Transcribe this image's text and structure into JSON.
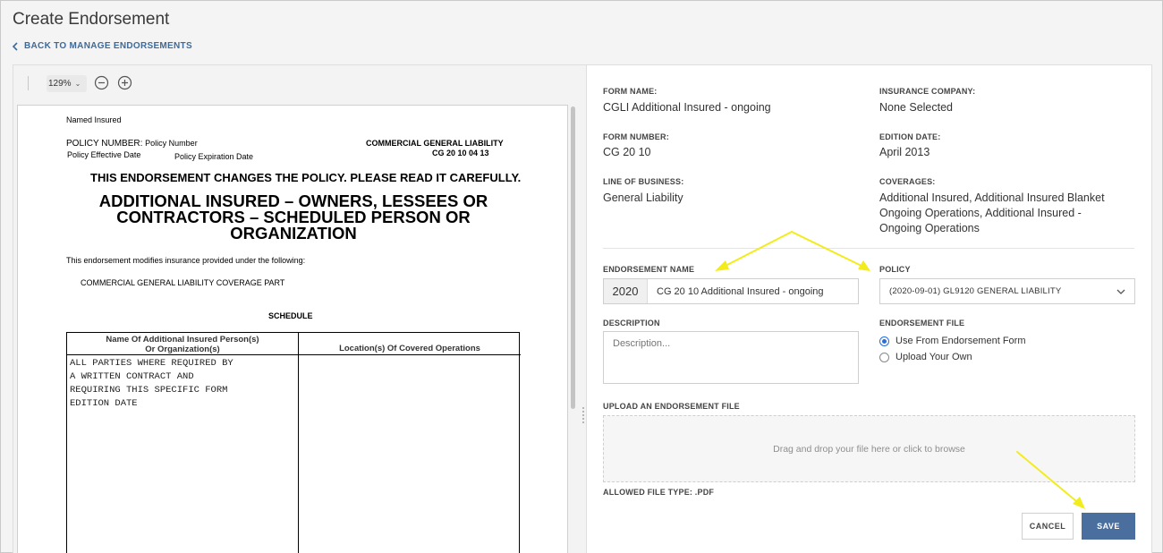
{
  "header": {
    "title": "Create Endorsement",
    "back_label": "BACK TO MANAGE ENDORSEMENTS"
  },
  "viewer": {
    "zoom_label": "129%",
    "zoom_caret_icon": "chevron-down-icon",
    "zoom_out_icon": "minus-circle-icon",
    "zoom_in_icon": "plus-circle-icon"
  },
  "document": {
    "named_insured": "Named Insured",
    "policy_number_label": "POLICY NUMBER:",
    "policy_number_value": "Policy Number",
    "effective_date": "Policy Effective Date",
    "expiration_date": "Policy Expiration Date",
    "coverage_type": "COMMERCIAL GENERAL LIABILITY",
    "form_code": "CG 20 10 04 13",
    "notice": "THIS ENDORSEMENT CHANGES THE POLICY.  PLEASE READ IT CAREFULLY.",
    "title_line1": "ADDITIONAL INSURED – OWNERS, LESSEES OR",
    "title_line2": "CONTRACTORS – SCHEDULED PERSON OR",
    "title_line3": "ORGANIZATION",
    "modifies": "This endorsement modifies insurance provided under the following:",
    "coverage_part": "COMMERCIAL GENERAL LIABILITY COVERAGE PART",
    "schedule_heading": "SCHEDULE",
    "schedule_col1_line1": "Name Of Additional Insured Person(s)",
    "schedule_col1_line2": "Or Organization(s)",
    "schedule_col2": "Location(s) Of Covered Operations",
    "schedule_entry": [
      "ALL PARTIES WHERE REQUIRED BY",
      "A WRITTEN CONTRACT AND",
      "REQUIRING THIS SPECIFIC FORM",
      "EDITION DATE"
    ]
  },
  "form": {
    "form_name_label": "FORM NAME:",
    "form_name": "CGLI Additional Insured - ongoing",
    "insurance_company_label": "INSURANCE COMPANY:",
    "insurance_company": "None Selected",
    "form_number_label": "FORM NUMBER:",
    "form_number": "CG 20 10",
    "edition_date_label": "EDITION DATE:",
    "edition_date": "April 2013",
    "line_of_business_label": "LINE OF BUSINESS:",
    "line_of_business": "General Liability",
    "coverages_label": "COVERAGES:",
    "coverages": [
      "Additional Insured, Additional Insured Blanket",
      "Ongoing Operations, Additional Insured -",
      "Ongoing Operations"
    ],
    "endorsement_name_label": "ENDORSEMENT NAME",
    "endorsement_prefix": "2020",
    "endorsement_name": "CG 20 10 Additional Insured - ongoing",
    "policy_label": "POLICY",
    "policy_value": "(2020-09-01) GL9120 GENERAL LIABILITY",
    "description_label": "DESCRIPTION",
    "description_placeholder": "Description...",
    "endorsement_file_label": "ENDORSEMENT FILE",
    "file_option_1": "Use From Endorsement Form",
    "file_option_2": "Upload Your Own",
    "upload_label": "UPLOAD AN ENDORSEMENT FILE",
    "dropzone_text": "Drag and drop your file here or click to browse",
    "allowed_types": "ALLOWED FILE TYPE: .PDF",
    "cancel_label": "CANCEL",
    "save_label": "SAVE"
  },
  "colors": {
    "link": "#3e6a99",
    "primary_button": "#4a6f9f",
    "radio_selected": "#2a6fd6",
    "annotation_arrow": "#f2ec1c"
  }
}
